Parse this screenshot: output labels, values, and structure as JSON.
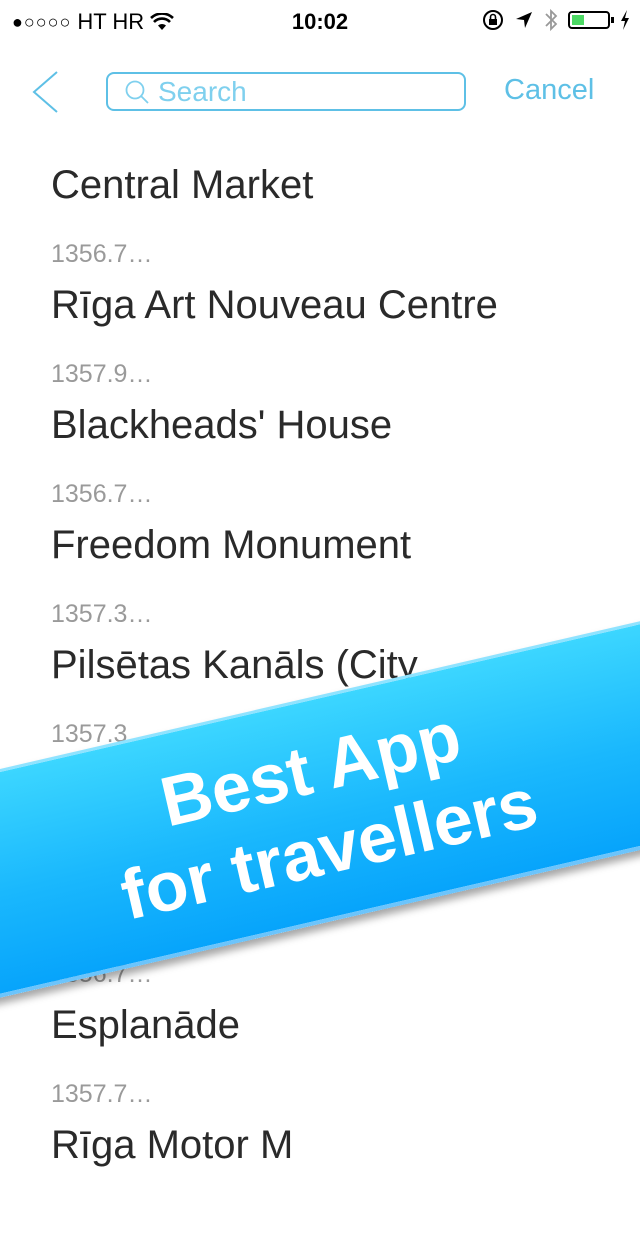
{
  "status_bar": {
    "signal": "●○○○○",
    "carrier": "HT HR",
    "time": "10:02",
    "battery_level": 0.35,
    "battery_color": "#4cd964"
  },
  "nav": {
    "search_placeholder": "Search",
    "search_value": "",
    "cancel_label": "Cancel",
    "accent_color": "#5ec0e6"
  },
  "list": [
    {
      "title": "Central Market",
      "distance": "1356.7…"
    },
    {
      "title": "Rīga Art Nouveau Centre",
      "distance": "1357.9…"
    },
    {
      "title": "Blackheads' House",
      "distance": "1356.7…"
    },
    {
      "title": "Freedom Monument",
      "distance": "1357.3…"
    },
    {
      "title": "Pilsētas Kanāls (City",
      "distance": "1357.3"
    },
    {
      "title": "",
      "distance": ""
    },
    {
      "title": "",
      "distance": "1356.7…"
    },
    {
      "title": "Esplanāde",
      "distance": "1357.7…"
    },
    {
      "title": "Rīga Motor M",
      "distance": ""
    }
  ],
  "banner": {
    "line1": "Best App",
    "line2": "for travellers"
  }
}
